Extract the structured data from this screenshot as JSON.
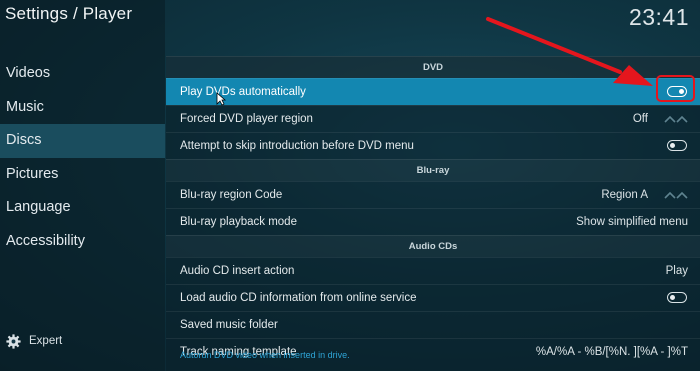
{
  "header": {
    "title": "Settings / Player",
    "clock": "23:41"
  },
  "sidebar": {
    "items": [
      {
        "label": "Videos",
        "active": false
      },
      {
        "label": "Music",
        "active": false
      },
      {
        "label": "Discs",
        "active": true
      },
      {
        "label": "Pictures",
        "active": false
      },
      {
        "label": "Language",
        "active": false
      },
      {
        "label": "Accessibility",
        "active": false
      }
    ],
    "expert_label": "Expert",
    "expert_icon": "gear-icon"
  },
  "sections": [
    {
      "title": "DVD",
      "rows": [
        {
          "label": "Play DVDs automatically",
          "control": "toggle",
          "state": "on",
          "selected": true
        },
        {
          "label": "Forced DVD player region",
          "value": "Off",
          "control": "spinner"
        },
        {
          "label": "Attempt to skip introduction before DVD menu",
          "control": "toggle",
          "state": "off"
        }
      ]
    },
    {
      "title": "Blu-ray",
      "rows": [
        {
          "label": "Blu-ray region Code",
          "value": "Region A",
          "control": "spinner"
        },
        {
          "label": "Blu-ray playback mode",
          "value": "Show simplified menu"
        }
      ]
    },
    {
      "title": "Audio CDs",
      "rows": [
        {
          "label": "Audio CD insert action",
          "value": "Play",
          "control": "spinner"
        },
        {
          "label": "Load audio CD information from online service",
          "control": "toggle",
          "state": "off"
        },
        {
          "label": "Saved music folder"
        },
        {
          "label": "Track naming template",
          "value": "%A/%A - %B/[%N. ][%A - ]%T"
        }
      ]
    }
  ],
  "hint_text": "Autorun DVD video when inserted in drive.",
  "colors": {
    "accent": "#1387b1",
    "annotation": "#e4161d",
    "hint": "#2ea4d6"
  }
}
